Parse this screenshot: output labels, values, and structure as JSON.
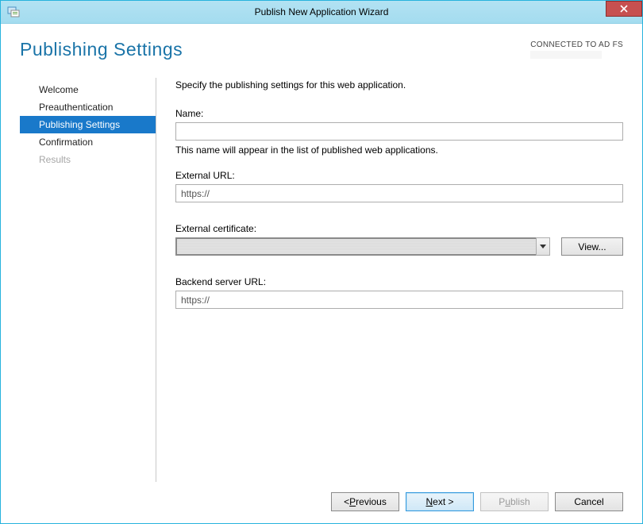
{
  "window": {
    "title": "Publish New Application Wizard",
    "close_label": "✕"
  },
  "header": {
    "heading": "Publishing Settings",
    "connection_status": "CONNECTED TO AD FS"
  },
  "nav": {
    "items": [
      {
        "label": "Welcome",
        "state": "normal"
      },
      {
        "label": "Preauthentication",
        "state": "normal"
      },
      {
        "label": "Publishing Settings",
        "state": "active"
      },
      {
        "label": "Confirmation",
        "state": "normal"
      },
      {
        "label": "Results",
        "state": "disabled"
      }
    ]
  },
  "form": {
    "description": "Specify the publishing settings for this web application.",
    "name_label": "Name:",
    "name_value": "",
    "name_helper": "This name will appear in the list of published web applications.",
    "external_url_label": "External URL:",
    "external_url_value": "https://",
    "cert_label": "External certificate:",
    "cert_selected": "",
    "view_button": "View...",
    "backend_label": "Backend server URL:",
    "backend_value": "https://"
  },
  "footer": {
    "previous": "< Previous",
    "next": "Next >",
    "publish": "Publish",
    "cancel": "Cancel"
  }
}
